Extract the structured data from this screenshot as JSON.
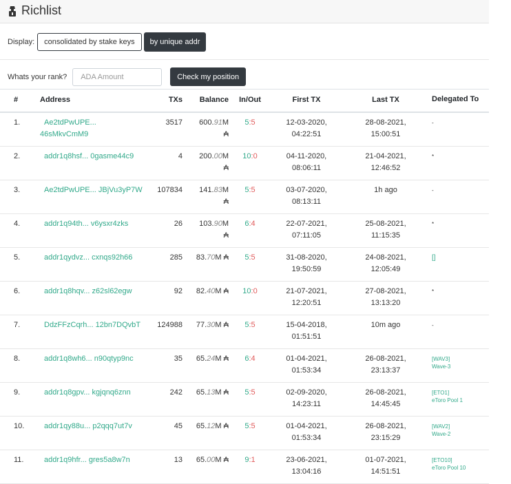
{
  "header": {
    "title": "Richlist",
    "icon": "miner-icon"
  },
  "display": {
    "label": "Display:",
    "option_consolidated": "consolidated by stake keys",
    "option_unique": "by unique addr"
  },
  "rank": {
    "label": "Whats your rank?",
    "placeholder": "ADA Amount",
    "button": "Check my position"
  },
  "table": {
    "columns": [
      "#",
      "Address",
      "TXs",
      "Balance",
      "In/Out",
      "First TX",
      "Last TX",
      "Delegated To"
    ],
    "rows": [
      {
        "num": "1.",
        "addr1": "Ae2tdPwUPE...",
        "addr2": "46sMkvCmM9",
        "txs": "3517",
        "bal_int": "600.",
        "bal_dec": "91",
        "bal_unit": "M",
        "inout_in": "5",
        "inout_out": "5",
        "first1": "12-03-2020,",
        "first2": "04:22:51",
        "last1": "28-08-2021,",
        "last2": "15:00:51",
        "del1": "-",
        "del2": ""
      },
      {
        "num": "2.",
        "addr1": "addr1q8hsf... 0gasme44c9",
        "addr2": "",
        "txs": "4",
        "bal_int": "200.",
        "bal_dec": "00",
        "bal_unit": "M",
        "inout_in": "10",
        "inout_out": "0",
        "first1": "04-11-2020,",
        "first2": "08:06:11",
        "last1": "21-04-2021,",
        "last2": "12:46:52",
        "del1": "*",
        "del2": ""
      },
      {
        "num": "3.",
        "addr1": "Ae2tdPwUPE... JBjVu3yP7W",
        "addr2": "",
        "txs": "107834",
        "bal_int": "141.",
        "bal_dec": "83",
        "bal_unit": "M",
        "inout_in": "5",
        "inout_out": "5",
        "first1": "03-07-2020,",
        "first2": "08:13:11",
        "last1": "1h ago",
        "last2": "",
        "del1": "-",
        "del2": ""
      },
      {
        "num": "4.",
        "addr1": "addr1q94th... v6ysxr4zks",
        "addr2": "",
        "txs": "26",
        "bal_int": "103.",
        "bal_dec": "90",
        "bal_unit": "M",
        "inout_in": "6",
        "inout_out": "4",
        "first1": "22-07-2021,",
        "first2": "07:11:05",
        "last1": "25-08-2021,",
        "last2": "11:15:35",
        "del1": "*",
        "del2": ""
      },
      {
        "num": "5.",
        "addr1": "addr1qydvz... cxnqs92h66",
        "addr2": "",
        "txs": "285",
        "bal_int": "83.",
        "bal_dec": "70",
        "bal_unit": "M",
        "inout_in": "5",
        "inout_out": "5",
        "first1": "31-08-2020,",
        "first2": "19:50:59",
        "last1": "24-08-2021,",
        "last2": "12:05:49",
        "del1": "[]",
        "del2": ""
      },
      {
        "num": "6.",
        "addr1": "addr1q8hqv... z62sl62egw",
        "addr2": "",
        "txs": "92",
        "bal_int": "82.",
        "bal_dec": "40",
        "bal_unit": "M",
        "inout_in": "10",
        "inout_out": "0",
        "first1": "21-07-2021,",
        "first2": "12:20:51",
        "last1": "27-08-2021,",
        "last2": "13:13:20",
        "del1": "*",
        "del2": ""
      },
      {
        "num": "7.",
        "addr1": "DdzFFzCqrh... 12bn7DQvbT",
        "addr2": "",
        "txs": "124988",
        "bal_int": "77.",
        "bal_dec": "30",
        "bal_unit": "M",
        "inout_in": "5",
        "inout_out": "5",
        "first1": "15-04-2018,",
        "first2": "01:51:51",
        "last1": "10m ago",
        "last2": "",
        "del1": "-",
        "del2": ""
      },
      {
        "num": "8.",
        "addr1": "addr1q8wh6... n90qtyp9nc",
        "addr2": "",
        "txs": "35",
        "bal_int": "65.",
        "bal_dec": "24",
        "bal_unit": "M",
        "inout_in": "6",
        "inout_out": "4",
        "first1": "01-04-2021,",
        "first2": "01:53:34",
        "last1": "26-08-2021,",
        "last2": "23:13:37",
        "del1": "[WAV3]",
        "del2": "Wave-3"
      },
      {
        "num": "9.",
        "addr1": "addr1q8gpv... kgjqnq6znn",
        "addr2": "",
        "txs": "242",
        "bal_int": "65.",
        "bal_dec": "13",
        "bal_unit": "M",
        "inout_in": "5",
        "inout_out": "5",
        "first1": "02-09-2020,",
        "first2": "14:23:11",
        "last1": "26-08-2021,",
        "last2": "14:45:45",
        "del1": "[ETO1]",
        "del2": "eToro Pool 1"
      },
      {
        "num": "10.",
        "addr1": "addr1qy88u... p2qqq7ut7v",
        "addr2": "",
        "txs": "45",
        "bal_int": "65.",
        "bal_dec": "12",
        "bal_unit": "M",
        "inout_in": "5",
        "inout_out": "5",
        "first1": "01-04-2021,",
        "first2": "01:53:34",
        "last1": "26-08-2021,",
        "last2": "23:15:29",
        "del1": "[WAV2]",
        "del2": "Wave-2"
      },
      {
        "num": "11.",
        "addr1": "addr1q9hfr... gres5a8w7n",
        "addr2": "",
        "txs": "13",
        "bal_int": "65.",
        "bal_dec": "00",
        "bal_unit": "M",
        "inout_in": "9",
        "inout_out": "1",
        "first1": "23-06-2021,",
        "first2": "13:04:16",
        "last1": "01-07-2021,",
        "last2": "14:51:51",
        "del1": "[ETO10]",
        "del2": "eToro Pool 10"
      }
    ]
  },
  "currency_symbol": "₳",
  "colors": {
    "link": "#31a98a",
    "out": "#e05a5a",
    "dark_button": "#343a40"
  }
}
